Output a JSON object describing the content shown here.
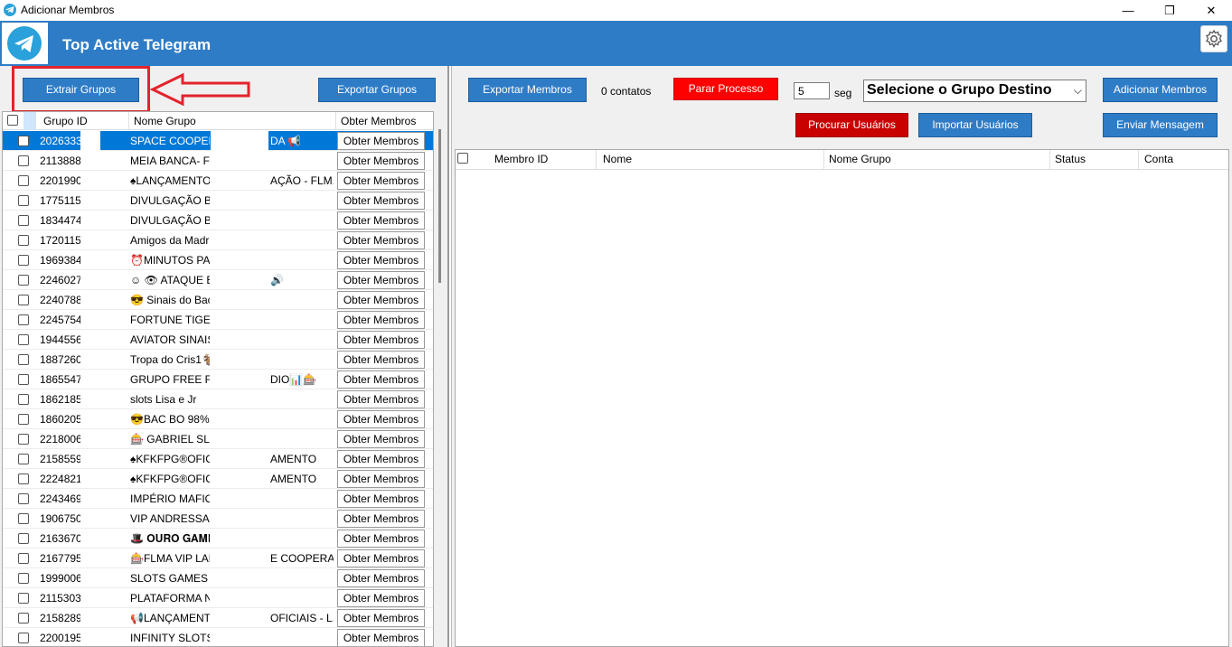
{
  "window": {
    "title": "Adicionar Membros"
  },
  "header": {
    "app_title": "Top Active Telegram"
  },
  "left": {
    "extract_label": "Extrair Grupos",
    "export_label": "Exportar Grupos",
    "columns": [
      "Grupo ID",
      "Nome Grupo",
      "Obter Membros"
    ],
    "rows": [
      {
        "id": "2026333",
        "name": "SPACE COOPERA",
        "name2": "DA 📢"
      },
      {
        "id": "2113888",
        "name": "MEIA BANCA- FP",
        "name2": ""
      },
      {
        "id": "2201990",
        "name": "♠LANÇAMENTO",
        "name2": "AÇÃO - FLM..."
      },
      {
        "id": "1775115",
        "name": "DIVULGAÇÃO BR",
        "name2": ""
      },
      {
        "id": "1834474",
        "name": "DIVULGAÇÃO BR",
        "name2": ""
      },
      {
        "id": "1720115",
        "name": "Amigos da Madrug",
        "name2": ""
      },
      {
        "id": "1969384",
        "name": "⏰MINUTOS PAG",
        "name2": ""
      },
      {
        "id": "2246027",
        "name": "☺ 👁 ATAQUE EN",
        "name2": "🔊"
      },
      {
        "id": "2240788",
        "name": "😎 Sinais do Bac E",
        "name2": ""
      },
      {
        "id": "2245754",
        "name": "FORTUNE TIGER",
        "name2": ""
      },
      {
        "id": "1944556",
        "name": "AVIATOR SINAIS",
        "name2": ""
      },
      {
        "id": "1887260",
        "name": "Tropa do Cris1🐐 🐐",
        "name2": ""
      },
      {
        "id": "1865547",
        "name": "GRUPO FREE FO",
        "name2": "DIO📊🎰"
      },
      {
        "id": "1862185",
        "name": "slots Lisa e Jr",
        "name2": ""
      },
      {
        "id": "1860205",
        "name": "😎BAC BO 98% DI",
        "name2": ""
      },
      {
        "id": "2218006",
        "name": "🎰 GABRIEL SLOT",
        "name2": ""
      },
      {
        "id": "2158559",
        "name": "♠KFKFPG®OFICI",
        "name2": "AMENTO"
      },
      {
        "id": "2224821",
        "name": "♠KFKFPG®OFICI",
        "name2": "AMENTO"
      },
      {
        "id": "2243469",
        "name": "IMPÉRIO MAFIOS",
        "name2": ""
      },
      {
        "id": "1906750",
        "name": "VIP ANDRESSA &",
        "name2": ""
      },
      {
        "id": "2163670",
        "name": "🎩 𝐎𝐔𝐑𝐎 𝐆𝐀𝐌𝐄 :",
        "name2": ""
      },
      {
        "id": "2167795",
        "name": "🎰FLMA VIP LANC",
        "name2": "E COOPERA..."
      },
      {
        "id": "1999006",
        "name": "SLOTS GAMES",
        "name2": ""
      },
      {
        "id": "2115303",
        "name": "PLATAFORMA NC",
        "name2": ""
      },
      {
        "id": "2158289",
        "name": "📢LANÇAMENTO",
        "name2": "OFICIAIS - L..."
      },
      {
        "id": "2200195",
        "name": "INFINITY SLOTS :",
        "name2": ""
      }
    ],
    "row_button_label": "Obter Membros"
  },
  "right": {
    "export_members_label": "Exportar Membros",
    "contacts_text": "0 contatos",
    "stop_label": "Parar Processo",
    "interval_value": "5",
    "interval_unit": "seg",
    "dest_select": "Selecione o Grupo Destino",
    "add_members_label": "Adicionar Membros",
    "search_users_label": "Procurar Usuários",
    "import_users_label": "Importar Usuários",
    "send_message_label": "Enviar Mensagem",
    "columns": [
      "Membro ID",
      "Nome",
      "Nome Grupo",
      "Status",
      "Conta"
    ]
  },
  "colors": {
    "brand_blue": "#2f7cc6",
    "selection_blue": "#0078d7",
    "stop_red": "#ff0000",
    "search_red": "#c90000",
    "annotation_red": "#e3242b"
  }
}
